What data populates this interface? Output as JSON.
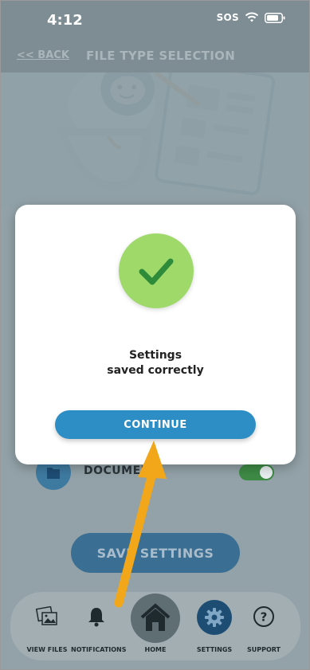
{
  "status_bar": {
    "time": "4:12",
    "sos": "SOS"
  },
  "header": {
    "back_label": "<< BACK",
    "title": "FILE TYPE SELECTION"
  },
  "background": {
    "doc_label": "DOCUMEN",
    "save_button": "SAVE SETTINGS"
  },
  "modal": {
    "message_line1": "Settings",
    "message_line2": "saved correctly",
    "continue_label": "CONTINUE"
  },
  "bottom_nav": {
    "items": [
      {
        "label": "VIEW FILES",
        "icon": "photos-icon"
      },
      {
        "label": "NOTIFICATIONS",
        "icon": "bell-icon"
      },
      {
        "label": "HOME",
        "icon": "house-icon"
      },
      {
        "label": "SETTINGS",
        "icon": "gear-icon"
      },
      {
        "label": "SUPPORT",
        "icon": "question-icon"
      }
    ]
  },
  "colors": {
    "accent": "#2d8ec6",
    "success": "#9ed96a",
    "check": "#2e8b3a",
    "arrow": "#f2a71b"
  }
}
